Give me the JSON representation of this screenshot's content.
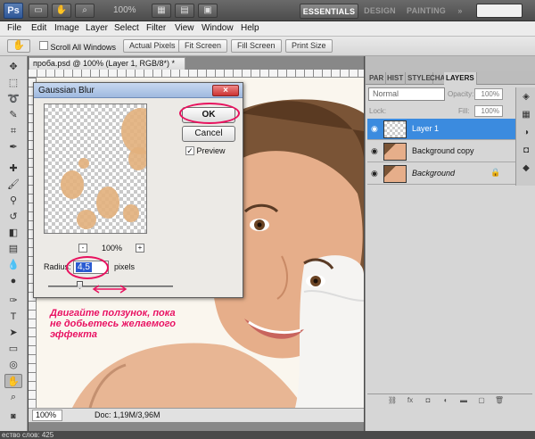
{
  "appbar": {
    "logo": "Ps",
    "zoom": "100%",
    "workspaces": [
      "ESSENTIALS",
      "DESIGN",
      "PAINTING"
    ],
    "more": "»",
    "icons": [
      "hand-tool-icon",
      "zoom-tool-icon",
      "view-grid-icon",
      "arrange-icon",
      "screen-mode-icon"
    ]
  },
  "menubar": {
    "items": [
      "File",
      "Edit",
      "Image",
      "Layer",
      "Select",
      "Filter",
      "View",
      "Window",
      "Help"
    ]
  },
  "options": {
    "scroll_all_label": "Scroll All Windows",
    "buttons": [
      "Actual Pixels",
      "Fit Screen",
      "Fill Screen",
      "Print Size"
    ]
  },
  "document": {
    "tab_title": "проба.psd @ 100% (Layer 1, RGB/8*) *",
    "zoom_value": "100%",
    "doc_info": "Doc: 1,19M/3,96M"
  },
  "status_bottom": "ество слов: 425",
  "dialog": {
    "title": "Gaussian Blur",
    "ok_label": "OK",
    "cancel_label": "Cancel",
    "preview_label": "Preview",
    "preview_checked": true,
    "zoom_label": "100%",
    "zoom_minus": "-",
    "zoom_plus": "+",
    "radius_label": "Radius:",
    "radius_value": "4,5",
    "radius_unit": "pixels"
  },
  "annotation": {
    "note": "Двигайте ползунок, пока не добьетесь желаемого эффекта",
    "color": "#e8115e"
  },
  "panel": {
    "tabs": [
      "PAR",
      "HIST",
      "STYLE",
      "CHA",
      "LAYERS"
    ],
    "blend_mode": "Normal",
    "opacity_label": "Opacity:",
    "opacity_value": "100%",
    "lock_label": "Lock:",
    "fill_label": "Fill:",
    "fill_value": "100%",
    "layers": [
      {
        "name": "Layer 1",
        "selected": true
      },
      {
        "name": "Background copy",
        "selected": false
      },
      {
        "name": "Background",
        "selected": false,
        "locked": true
      }
    ]
  },
  "colors": {
    "foreground": "#e2001a",
    "background": "#ffffff",
    "selection": "#3b8bdf"
  }
}
